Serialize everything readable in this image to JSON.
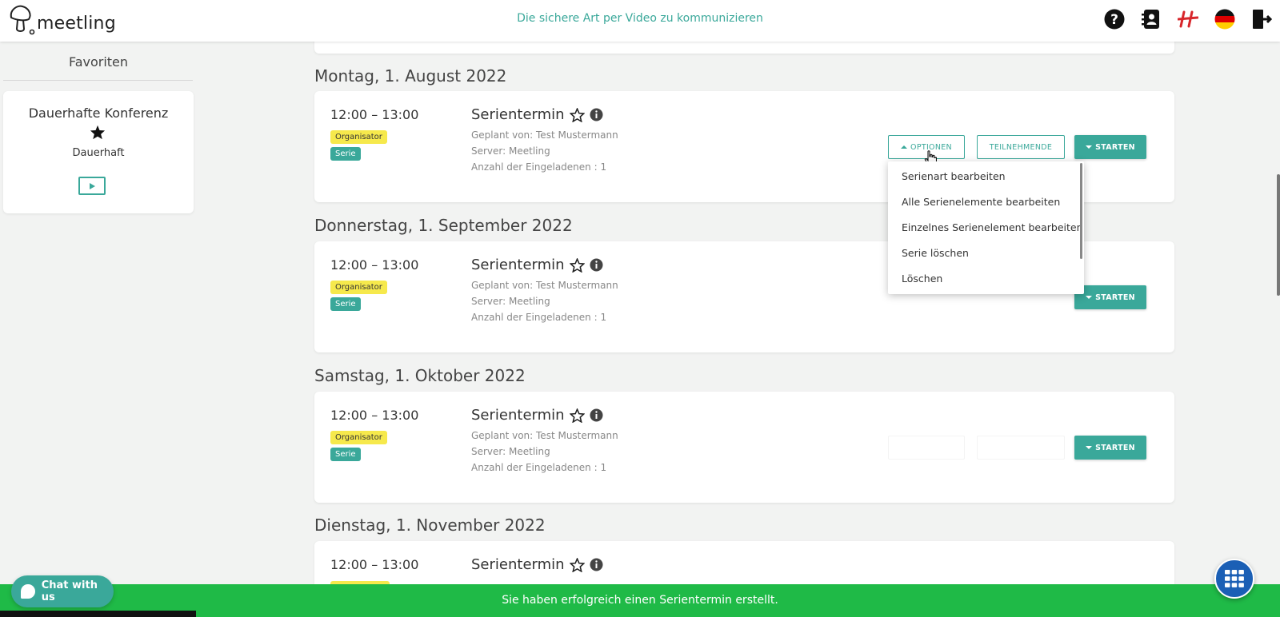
{
  "app": {
    "logo_text": "meetling",
    "tagline": "Die sichere Art per Video zu kommunizieren"
  },
  "header_icons": [
    "help-icon",
    "contacts-icon",
    "brand-h-icon",
    "german-flag-icon",
    "logout-icon"
  ],
  "sidebar": {
    "title": "Favoriten",
    "favorite": {
      "name": "Dauerhafte Konferenz",
      "type": "Dauerhaft"
    }
  },
  "events": [
    {
      "date": "Montag, 1. August 2022",
      "time": "12:00 – 13:00",
      "badges": [
        "Organisator",
        "Serie"
      ],
      "title": "Serientermin",
      "planned_by": "Geplant von: Test Mustermann",
      "server": "Server: Meetling",
      "invited": "Anzahl der Eingeladenen : 1"
    },
    {
      "date": "Donnerstag, 1. September 2022",
      "time": "12:00 – 13:00",
      "badges": [
        "Organisator",
        "Serie"
      ],
      "title": "Serientermin",
      "planned_by": "Geplant von: Test Mustermann",
      "server": "Server: Meetling",
      "invited": "Anzahl der Eingeladenen : 1"
    },
    {
      "date": "Samstag, 1. Oktober 2022",
      "time": "12:00 – 13:00",
      "badges": [
        "Organisator",
        "Serie"
      ],
      "title": "Serientermin",
      "planned_by": "Geplant von: Test Mustermann",
      "server": "Server: Meetling",
      "invited": "Anzahl der Eingeladenen : 1"
    },
    {
      "date": "Dienstag, 1. November 2022",
      "time": "12:00 – 13:00",
      "title": "Serientermin"
    }
  ],
  "buttons": {
    "options": "OPTIONEN",
    "participants": "TEILNEHMENDE",
    "start": "STARTEN"
  },
  "options_menu": [
    "Serienart bearbeiten",
    "Alle Serienelemente bearbeiten",
    "Einzelnes Serienelement bearbeiten",
    "Serie löschen",
    "Löschen"
  ],
  "toast": "Sie haben erfolgreich einen Serientermin erstellt.",
  "chat": {
    "label": "Chat with us"
  },
  "colors": {
    "accent": "#3aa89a",
    "badge_yellow": "#f6e94c",
    "toast_green": "#1fba47",
    "apps_blue": "#1b5fb5"
  }
}
